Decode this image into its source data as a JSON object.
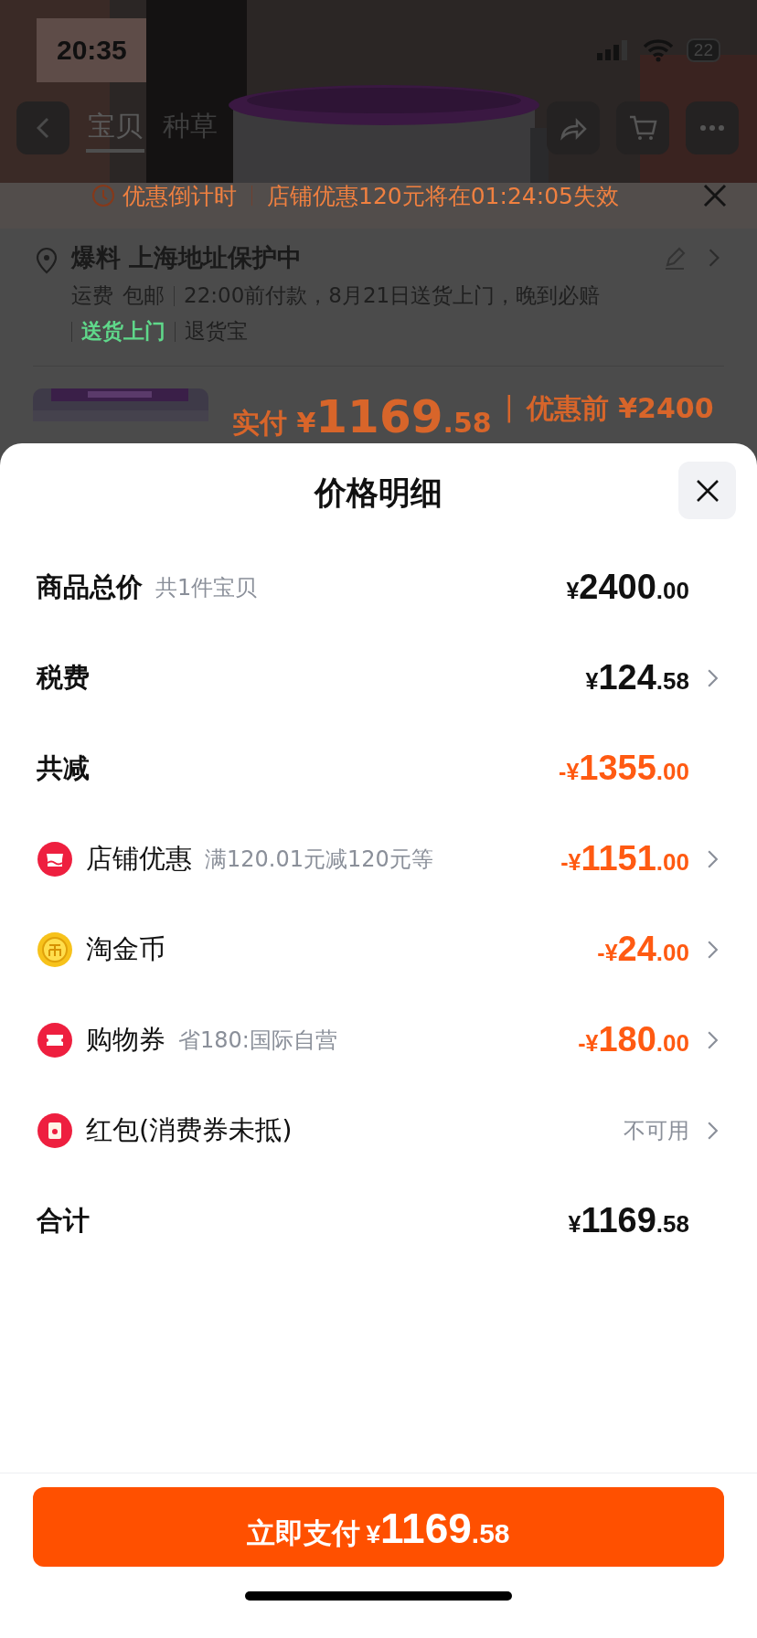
{
  "status_bar": {
    "time": "20:35",
    "battery": "22"
  },
  "nav": {
    "tabs": [
      {
        "label": "宝贝",
        "selected": true
      },
      {
        "label": "种草",
        "selected": false
      }
    ]
  },
  "countdown": {
    "label": "优惠倒计时",
    "message": "店铺优惠120元将在01:24:05失效"
  },
  "address": {
    "title": "爆料 上海地址保护中",
    "shipping_label": "运费",
    "shipping_value": "包邮",
    "delivery": "22:00前付款，8月21日送货上门，晚到必赔",
    "tags": [
      {
        "label": "送货上门",
        "highlight": true
      },
      {
        "label": "退货宝",
        "highlight": false
      }
    ]
  },
  "order_summary": {
    "label": "实付",
    "currency": "¥",
    "whole": "1169",
    "cents": ".58",
    "separator": "|",
    "original": "优惠前 ¥2400"
  },
  "sheet": {
    "title": "价格明细",
    "rows": [
      {
        "kind": "summary",
        "label": "商品总价",
        "note": "共1件宝贝",
        "amount": {
          "prefix": "¥",
          "whole": "2400",
          "cents": ".00"
        },
        "deduction": false,
        "chevron": false
      },
      {
        "kind": "summary",
        "label": "税费",
        "amount": {
          "prefix": "¥",
          "whole": "124",
          "cents": ".58"
        },
        "deduction": false,
        "chevron": true
      },
      {
        "kind": "summary",
        "label": "共减",
        "amount": {
          "prefix": "-¥",
          "whole": "1355",
          "cents": ".00"
        },
        "deduction": true,
        "chevron": false
      },
      {
        "kind": "shop_discount",
        "label": "店铺优惠",
        "note": "满120.01元减120元等",
        "amount": {
          "prefix": "-¥",
          "whole": "1151",
          "cents": ".00"
        },
        "deduction": true,
        "chevron": true
      },
      {
        "kind": "coins",
        "label": "淘金币",
        "amount": {
          "prefix": "-¥",
          "whole": "24",
          "cents": ".00"
        },
        "deduction": true,
        "chevron": true
      },
      {
        "kind": "coupon",
        "label": "购物券",
        "note": "省180:国际自营",
        "amount": {
          "prefix": "-¥",
          "whole": "180",
          "cents": ".00"
        },
        "deduction": true,
        "chevron": true
      },
      {
        "kind": "red_packet",
        "label": "红包(消费券未抵)",
        "status": "不可用",
        "deduction": false,
        "chevron": true
      },
      {
        "kind": "summary",
        "label": "合计",
        "amount": {
          "prefix": "¥",
          "whole": "1169",
          "cents": ".58"
        },
        "deduction": false,
        "chevron": false
      }
    ],
    "pay_button": {
      "label": "立即支付",
      "currency": "¥",
      "whole": "1169",
      "cents": ".58"
    }
  }
}
